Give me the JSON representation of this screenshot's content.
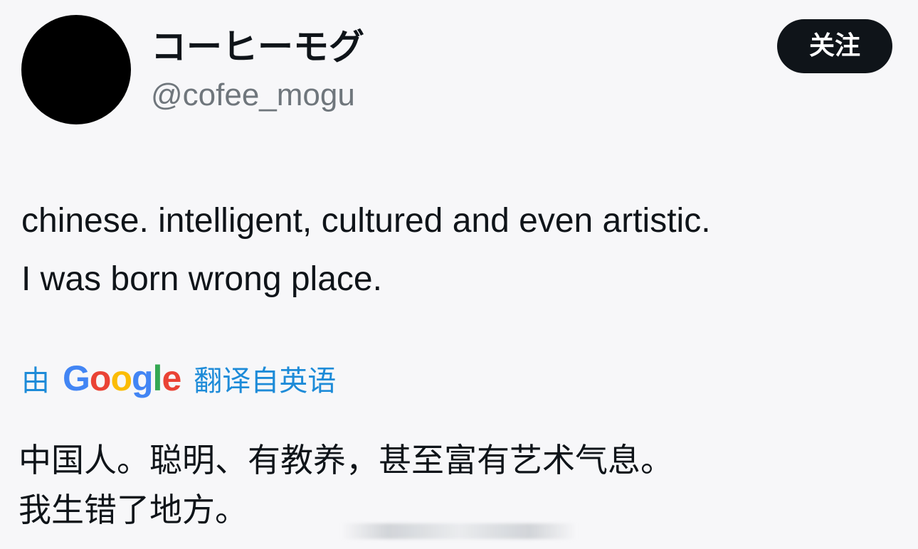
{
  "author": {
    "display_name": "コーヒーモグ",
    "handle": "@cofee_mogu",
    "avatar_icon": "avatar-black-circle"
  },
  "follow_button": {
    "label": "关注"
  },
  "tweet": {
    "lines": [
      "chinese. intelligent, cultured and even artistic.",
      "I was born wrong place."
    ]
  },
  "translation": {
    "prefix": "由",
    "provider": "Google",
    "suffix": "翻译自英语",
    "link_color": "#1d8bd8",
    "lines": [
      "中国人。聪明、有教养，甚至富有艺术气息。",
      "我生错了地方。"
    ]
  }
}
